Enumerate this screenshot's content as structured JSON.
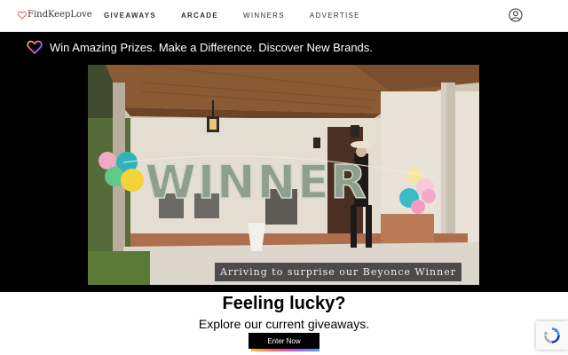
{
  "header": {
    "logo_text": "FindKeepLove",
    "nav": [
      {
        "label": "GIVEAWAYS",
        "bold": true
      },
      {
        "label": "ARCADE",
        "bold": true
      },
      {
        "label": "WINNERS",
        "bold": false
      },
      {
        "label": "ADVERTISE",
        "bold": false
      }
    ],
    "account_icon": "user-circle-icon"
  },
  "banner": {
    "tagline": "Win Amazing Prizes. Make a Difference. Discover New Brands.",
    "tagline_icon": "gradient-heart-icon",
    "video": {
      "balloon_text": "WINNER",
      "caption": "Arriving to surprise our Beyonce Winner"
    }
  },
  "cta": {
    "heading": "Feeling lucky?",
    "subheading": "Explore our current giveaways.",
    "button_label": "Enter Now"
  },
  "recaptcha": {
    "icon": "recaptcha-icon"
  },
  "colors": {
    "banner_bg": "#000000",
    "button_bg": "#000000",
    "button_underline": [
      "#f9c233",
      "#f36b6b",
      "#b05cf5",
      "#4aa8ff"
    ]
  }
}
